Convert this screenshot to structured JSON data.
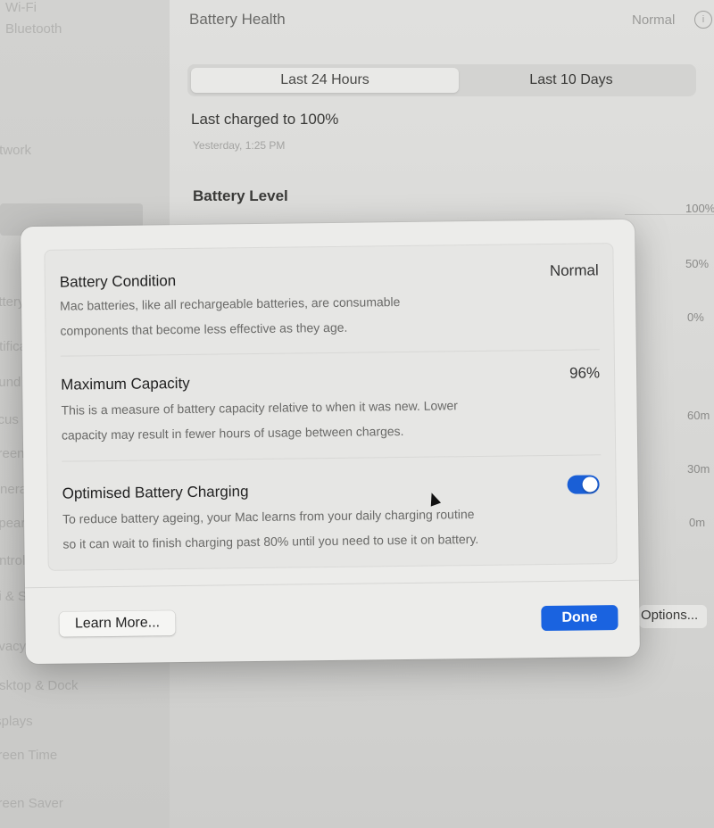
{
  "sidebar": {
    "items": [
      "Wi-Fi",
      "Bluetooth",
      "Network",
      "Battery",
      "Notifications",
      "Sound",
      "Focus",
      "Screen Time",
      "General",
      "Appearance",
      "Control Centre",
      "Siri & Spotlight",
      "Privacy & Security",
      "Desktop & Dock",
      "Displays",
      "Screen Time",
      "Screen Saver"
    ]
  },
  "background": {
    "title": "Battery Health",
    "status": "Normal",
    "tabs": [
      "Last 24 Hours",
      "Last 10 Days"
    ],
    "last_charged": "Last charged to 100%",
    "last_charged_time": "Yesterday, 1:25 PM",
    "battery_level_label": "Battery Level",
    "axis_labels": [
      "100%",
      "50%",
      "0%",
      "60m",
      "30m",
      "0m"
    ],
    "options_button": "Options..."
  },
  "sheet": {
    "battery_condition": {
      "title": "Battery Condition",
      "value": "Normal",
      "description_line1": "Mac batteries, like all rechargeable batteries, are consumable",
      "description_line2": "components that become less effective as they age."
    },
    "maximum_capacity": {
      "title": "Maximum Capacity",
      "value": "96%",
      "description_line1": "This is a measure of battery capacity relative to when it was new. Lower",
      "description_line2": "capacity may result in fewer hours of usage between charges."
    },
    "optimised_charging": {
      "title": "Optimised Battery Charging",
      "enabled": true,
      "description_line1": "To reduce battery ageing, your Mac learns from your daily charging routine",
      "description_line2": "so it can wait to finish charging past 80% until you need to use it on battery."
    },
    "learn_more_button": "Learn More...",
    "done_button": "Done"
  },
  "colors": {
    "accent": "#1a63e0",
    "toggle_on": "#1a5fd6"
  }
}
